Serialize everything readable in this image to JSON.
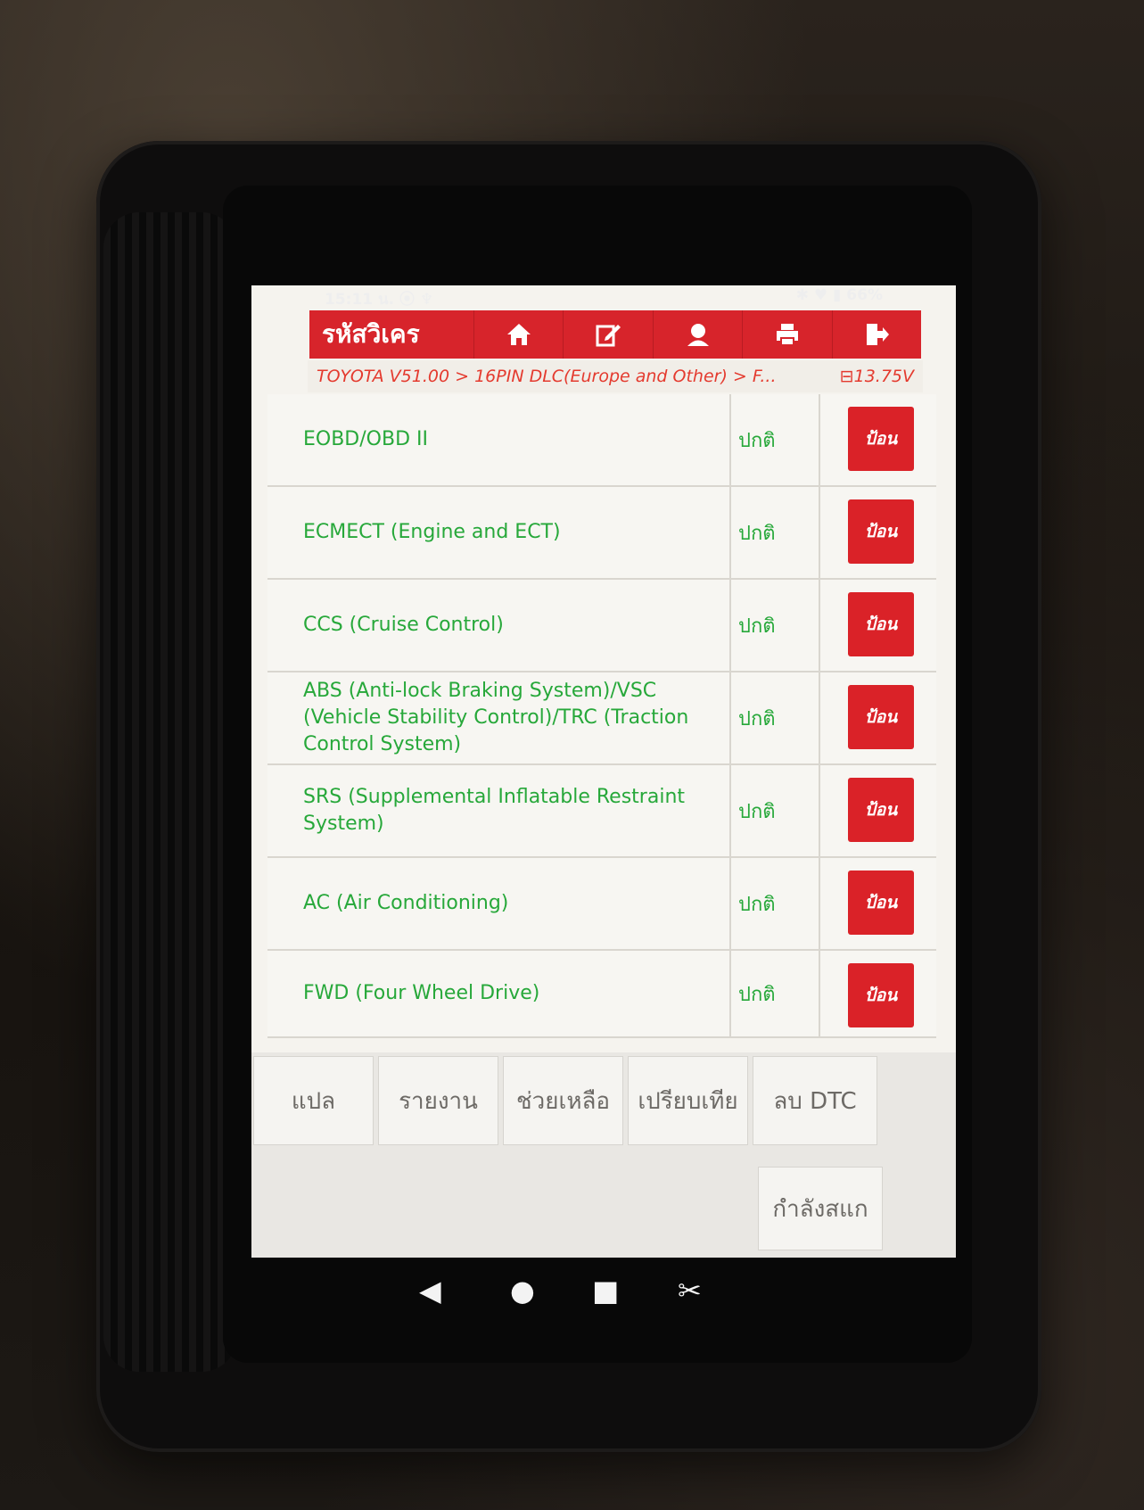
{
  "status_bar": {
    "time": "15:11 น.",
    "left_icons": "⦿ ♆",
    "right_icons": "✱ ♥ ▮",
    "battery": "66%"
  },
  "toolbar": {
    "title": "รหัสวิเคร",
    "icons": [
      "home-icon",
      "edit-icon",
      "user-icon",
      "print-icon",
      "exit-icon"
    ]
  },
  "breadcrumb": {
    "path": "TOYOTA V51.00 > 16PIN DLC(Europe and Other) > F...",
    "voltage": "13.75V"
  },
  "systems": [
    {
      "name": "EOBD/OBD II",
      "status": "ปกติ",
      "action": "ป้อน"
    },
    {
      "name": "ECMECT (Engine and ECT)",
      "status": "ปกติ",
      "action": "ป้อน"
    },
    {
      "name": "CCS (Cruise Control)",
      "status": "ปกติ",
      "action": "ป้อน"
    },
    {
      "name": "ABS (Anti-lock Braking System)/VSC (Vehicle Stability Control)/TRC (Traction Control System)",
      "status": "ปกติ",
      "action": "ป้อน"
    },
    {
      "name": "SRS (Supplemental Inflatable Restraint System)",
      "status": "ปกติ",
      "action": "ป้อน"
    },
    {
      "name": "AC (Air Conditioning)",
      "status": "ปกติ",
      "action": "ป้อน"
    },
    {
      "name": "FWD (Four Wheel Drive)",
      "status": "ปกติ",
      "action": "ป้อน"
    }
  ],
  "bottom_buttons": {
    "translate": "แปล",
    "report": "รายงาน",
    "help": "ช่วยเหลือ",
    "compare": "เปรียบเทีย",
    "clear_dtc": "ลบ DTC",
    "scanning": "กำลังสแก"
  },
  "nav": {
    "back": "◀",
    "home": "●",
    "recents": "■",
    "screenshot": "✂"
  }
}
